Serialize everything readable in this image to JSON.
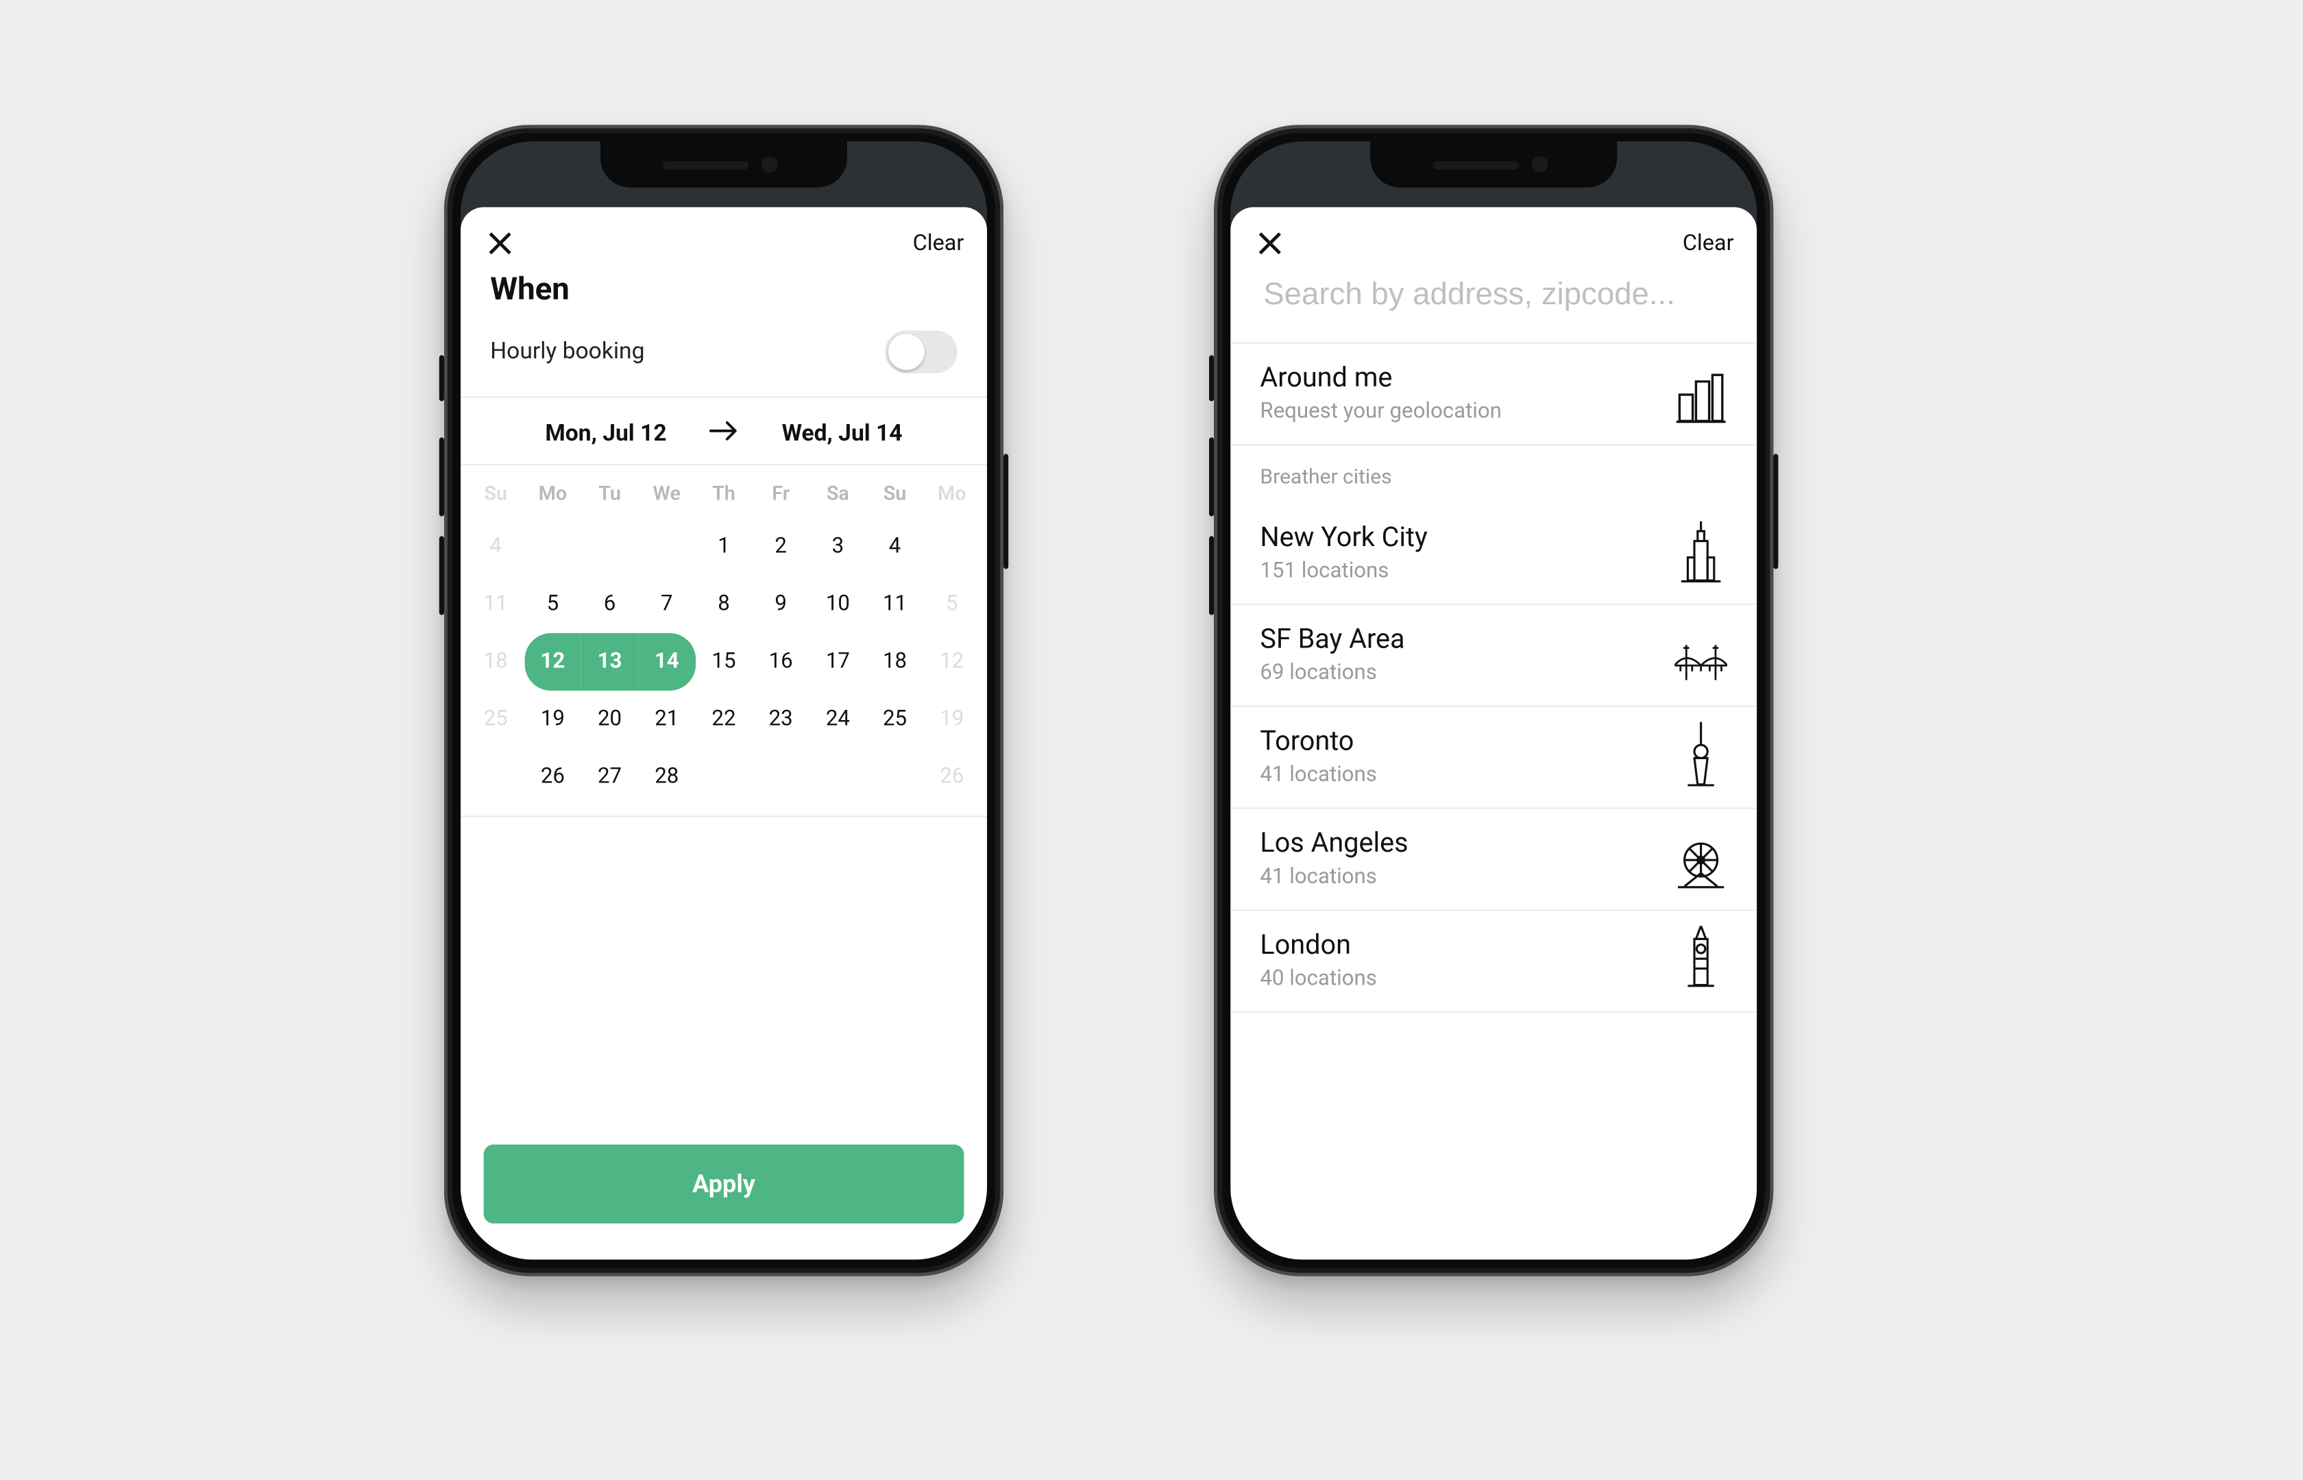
{
  "left": {
    "clear": "Clear",
    "title": "When",
    "toggle_label": "Hourly booking",
    "toggle_on": false,
    "range_start": "Mon, Jul 12",
    "range_end": "Wed, Jul 14",
    "weekdays_edge_left": "Su",
    "weekdays": [
      "Mo",
      "Tu",
      "We",
      "Th",
      "Fr",
      "Sa",
      "Su"
    ],
    "weekdays_edge_right": "Mo",
    "rows": [
      {
        "edge_left": "4",
        "cells": [
          "",
          "",
          "",
          "1",
          "2",
          "3",
          "4"
        ],
        "edge_right": ""
      },
      {
        "edge_left": "11",
        "cells": [
          "5",
          "6",
          "7",
          "8",
          "9",
          "10",
          "11"
        ],
        "edge_right": "5"
      },
      {
        "edge_left": "18",
        "cells": [
          "12",
          "13",
          "14",
          "15",
          "16",
          "17",
          "18"
        ],
        "edge_right": "12",
        "sel_start": 0,
        "sel_end": 2
      },
      {
        "edge_left": "25",
        "cells": [
          "19",
          "20",
          "21",
          "22",
          "23",
          "24",
          "25"
        ],
        "edge_right": "19"
      },
      {
        "edge_left": "",
        "cells": [
          "26",
          "27",
          "28",
          "",
          "",
          "",
          ""
        ],
        "edge_right": "26"
      }
    ],
    "apply": "Apply"
  },
  "right": {
    "clear": "Clear",
    "search_placeholder": "Search by address, zipcode...",
    "around": {
      "title": "Around me",
      "subtitle": "Request your geolocation"
    },
    "section": "Breather cities",
    "cities": [
      {
        "name": "New York City",
        "sub": "151 locations",
        "icon": "nyc"
      },
      {
        "name": "SF Bay Area",
        "sub": "69 locations",
        "icon": "sf"
      },
      {
        "name": "Toronto",
        "sub": "41 locations",
        "icon": "toronto"
      },
      {
        "name": "Los Angeles",
        "sub": "41 locations",
        "icon": "la"
      },
      {
        "name": "London",
        "sub": "40 locations",
        "icon": "london"
      }
    ]
  }
}
